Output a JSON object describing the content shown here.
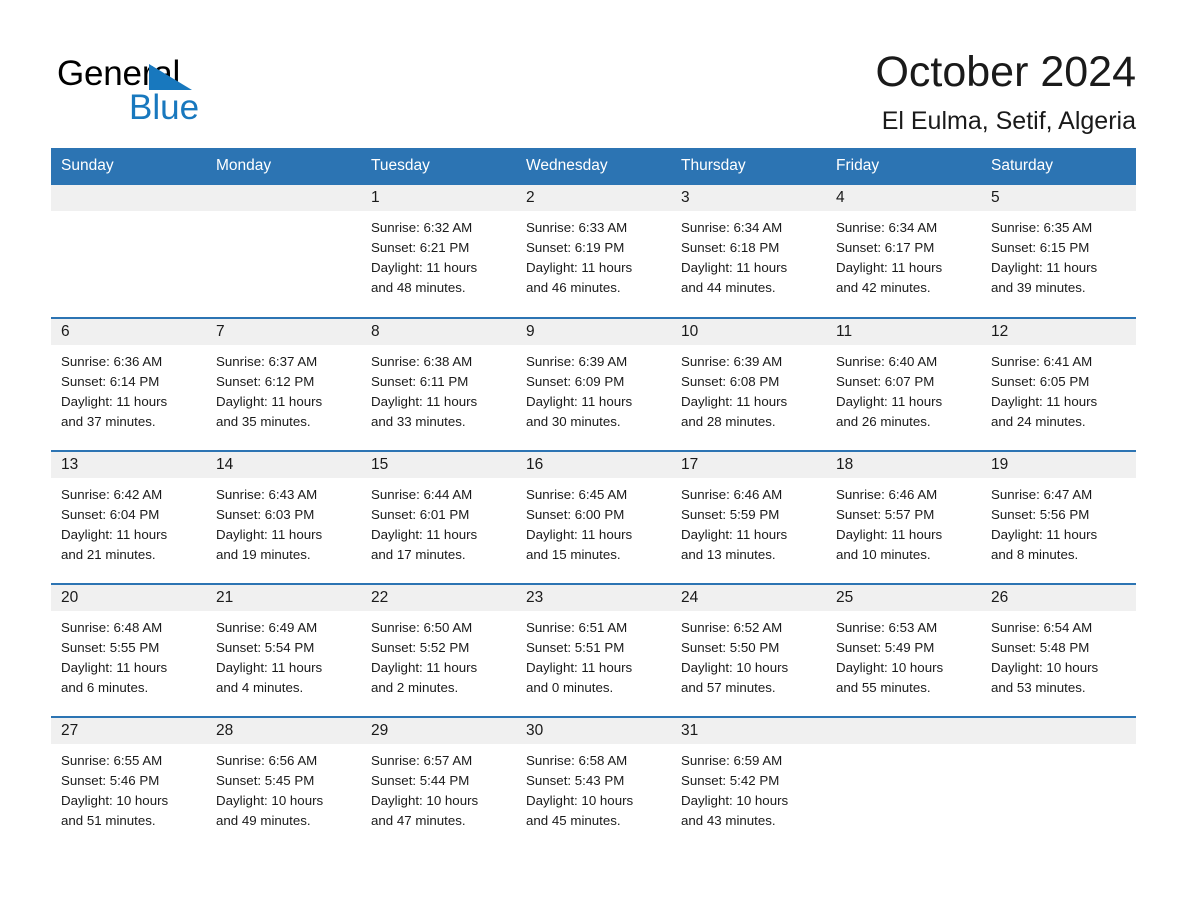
{
  "brand": {
    "name_part1": "General",
    "name_part2": "Blue",
    "triangle_color": "#1878be"
  },
  "header": {
    "month_title": "October 2024",
    "location": "El Eulma, Setif, Algeria",
    "accent_color": "#2c74b3",
    "daynum_bg": "#f0f0f0"
  },
  "calendar": {
    "weekday_headers": [
      "Sunday",
      "Monday",
      "Tuesday",
      "Wednesday",
      "Thursday",
      "Friday",
      "Saturday"
    ],
    "weeks": [
      [
        {
          "day": "",
          "sunrise": "",
          "sunset": "",
          "daylight1": "",
          "daylight2": "",
          "empty": true
        },
        {
          "day": "",
          "sunrise": "",
          "sunset": "",
          "daylight1": "",
          "daylight2": "",
          "empty": true
        },
        {
          "day": "1",
          "sunrise": "Sunrise: 6:32 AM",
          "sunset": "Sunset: 6:21 PM",
          "daylight1": "Daylight: 11 hours",
          "daylight2": "and 48 minutes.",
          "empty": false
        },
        {
          "day": "2",
          "sunrise": "Sunrise: 6:33 AM",
          "sunset": "Sunset: 6:19 PM",
          "daylight1": "Daylight: 11 hours",
          "daylight2": "and 46 minutes.",
          "empty": false
        },
        {
          "day": "3",
          "sunrise": "Sunrise: 6:34 AM",
          "sunset": "Sunset: 6:18 PM",
          "daylight1": "Daylight: 11 hours",
          "daylight2": "and 44 minutes.",
          "empty": false
        },
        {
          "day": "4",
          "sunrise": "Sunrise: 6:34 AM",
          "sunset": "Sunset: 6:17 PM",
          "daylight1": "Daylight: 11 hours",
          "daylight2": "and 42 minutes.",
          "empty": false
        },
        {
          "day": "5",
          "sunrise": "Sunrise: 6:35 AM",
          "sunset": "Sunset: 6:15 PM",
          "daylight1": "Daylight: 11 hours",
          "daylight2": "and 39 minutes.",
          "empty": false
        }
      ],
      [
        {
          "day": "6",
          "sunrise": "Sunrise: 6:36 AM",
          "sunset": "Sunset: 6:14 PM",
          "daylight1": "Daylight: 11 hours",
          "daylight2": "and 37 minutes.",
          "empty": false
        },
        {
          "day": "7",
          "sunrise": "Sunrise: 6:37 AM",
          "sunset": "Sunset: 6:12 PM",
          "daylight1": "Daylight: 11 hours",
          "daylight2": "and 35 minutes.",
          "empty": false
        },
        {
          "day": "8",
          "sunrise": "Sunrise: 6:38 AM",
          "sunset": "Sunset: 6:11 PM",
          "daylight1": "Daylight: 11 hours",
          "daylight2": "and 33 minutes.",
          "empty": false
        },
        {
          "day": "9",
          "sunrise": "Sunrise: 6:39 AM",
          "sunset": "Sunset: 6:09 PM",
          "daylight1": "Daylight: 11 hours",
          "daylight2": "and 30 minutes.",
          "empty": false
        },
        {
          "day": "10",
          "sunrise": "Sunrise: 6:39 AM",
          "sunset": "Sunset: 6:08 PM",
          "daylight1": "Daylight: 11 hours",
          "daylight2": "and 28 minutes.",
          "empty": false
        },
        {
          "day": "11",
          "sunrise": "Sunrise: 6:40 AM",
          "sunset": "Sunset: 6:07 PM",
          "daylight1": "Daylight: 11 hours",
          "daylight2": "and 26 minutes.",
          "empty": false
        },
        {
          "day": "12",
          "sunrise": "Sunrise: 6:41 AM",
          "sunset": "Sunset: 6:05 PM",
          "daylight1": "Daylight: 11 hours",
          "daylight2": "and 24 minutes.",
          "empty": false
        }
      ],
      [
        {
          "day": "13",
          "sunrise": "Sunrise: 6:42 AM",
          "sunset": "Sunset: 6:04 PM",
          "daylight1": "Daylight: 11 hours",
          "daylight2": "and 21 minutes.",
          "empty": false
        },
        {
          "day": "14",
          "sunrise": "Sunrise: 6:43 AM",
          "sunset": "Sunset: 6:03 PM",
          "daylight1": "Daylight: 11 hours",
          "daylight2": "and 19 minutes.",
          "empty": false
        },
        {
          "day": "15",
          "sunrise": "Sunrise: 6:44 AM",
          "sunset": "Sunset: 6:01 PM",
          "daylight1": "Daylight: 11 hours",
          "daylight2": "and 17 minutes.",
          "empty": false
        },
        {
          "day": "16",
          "sunrise": "Sunrise: 6:45 AM",
          "sunset": "Sunset: 6:00 PM",
          "daylight1": "Daylight: 11 hours",
          "daylight2": "and 15 minutes.",
          "empty": false
        },
        {
          "day": "17",
          "sunrise": "Sunrise: 6:46 AM",
          "sunset": "Sunset: 5:59 PM",
          "daylight1": "Daylight: 11 hours",
          "daylight2": "and 13 minutes.",
          "empty": false
        },
        {
          "day": "18",
          "sunrise": "Sunrise: 6:46 AM",
          "sunset": "Sunset: 5:57 PM",
          "daylight1": "Daylight: 11 hours",
          "daylight2": "and 10 minutes.",
          "empty": false
        },
        {
          "day": "19",
          "sunrise": "Sunrise: 6:47 AM",
          "sunset": "Sunset: 5:56 PM",
          "daylight1": "Daylight: 11 hours",
          "daylight2": "and 8 minutes.",
          "empty": false
        }
      ],
      [
        {
          "day": "20",
          "sunrise": "Sunrise: 6:48 AM",
          "sunset": "Sunset: 5:55 PM",
          "daylight1": "Daylight: 11 hours",
          "daylight2": "and 6 minutes.",
          "empty": false
        },
        {
          "day": "21",
          "sunrise": "Sunrise: 6:49 AM",
          "sunset": "Sunset: 5:54 PM",
          "daylight1": "Daylight: 11 hours",
          "daylight2": "and 4 minutes.",
          "empty": false
        },
        {
          "day": "22",
          "sunrise": "Sunrise: 6:50 AM",
          "sunset": "Sunset: 5:52 PM",
          "daylight1": "Daylight: 11 hours",
          "daylight2": "and 2 minutes.",
          "empty": false
        },
        {
          "day": "23",
          "sunrise": "Sunrise: 6:51 AM",
          "sunset": "Sunset: 5:51 PM",
          "daylight1": "Daylight: 11 hours",
          "daylight2": "and 0 minutes.",
          "empty": false
        },
        {
          "day": "24",
          "sunrise": "Sunrise: 6:52 AM",
          "sunset": "Sunset: 5:50 PM",
          "daylight1": "Daylight: 10 hours",
          "daylight2": "and 57 minutes.",
          "empty": false
        },
        {
          "day": "25",
          "sunrise": "Sunrise: 6:53 AM",
          "sunset": "Sunset: 5:49 PM",
          "daylight1": "Daylight: 10 hours",
          "daylight2": "and 55 minutes.",
          "empty": false
        },
        {
          "day": "26",
          "sunrise": "Sunrise: 6:54 AM",
          "sunset": "Sunset: 5:48 PM",
          "daylight1": "Daylight: 10 hours",
          "daylight2": "and 53 minutes.",
          "empty": false
        }
      ],
      [
        {
          "day": "27",
          "sunrise": "Sunrise: 6:55 AM",
          "sunset": "Sunset: 5:46 PM",
          "daylight1": "Daylight: 10 hours",
          "daylight2": "and 51 minutes.",
          "empty": false
        },
        {
          "day": "28",
          "sunrise": "Sunrise: 6:56 AM",
          "sunset": "Sunset: 5:45 PM",
          "daylight1": "Daylight: 10 hours",
          "daylight2": "and 49 minutes.",
          "empty": false
        },
        {
          "day": "29",
          "sunrise": "Sunrise: 6:57 AM",
          "sunset": "Sunset: 5:44 PM",
          "daylight1": "Daylight: 10 hours",
          "daylight2": "and 47 minutes.",
          "empty": false
        },
        {
          "day": "30",
          "sunrise": "Sunrise: 6:58 AM",
          "sunset": "Sunset: 5:43 PM",
          "daylight1": "Daylight: 10 hours",
          "daylight2": "and 45 minutes.",
          "empty": false
        },
        {
          "day": "31",
          "sunrise": "Sunrise: 6:59 AM",
          "sunset": "Sunset: 5:42 PM",
          "daylight1": "Daylight: 10 hours",
          "daylight2": "and 43 minutes.",
          "empty": false
        },
        {
          "day": "",
          "sunrise": "",
          "sunset": "",
          "daylight1": "",
          "daylight2": "",
          "empty": true
        },
        {
          "day": "",
          "sunrise": "",
          "sunset": "",
          "daylight1": "",
          "daylight2": "",
          "empty": true
        }
      ]
    ]
  }
}
